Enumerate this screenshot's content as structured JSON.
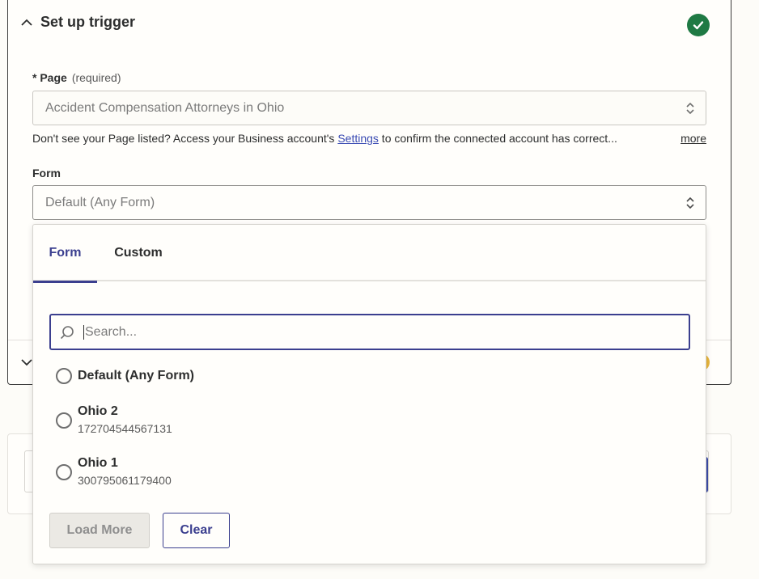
{
  "trigger": {
    "title": "Set up trigger",
    "status": "complete",
    "status_color": "#1f7a44"
  },
  "page_field": {
    "label": "Page",
    "required_marker": "*",
    "required_text": "(required)",
    "value": "Accident Compensation Attorneys in Ohio"
  },
  "help": {
    "prefix": "Don't see your Page listed? Access your Business account's ",
    "link": "Settings",
    "suffix": " to confirm the connected account has correct...",
    "more": "more"
  },
  "form_field": {
    "label": "Form",
    "value": "Default (Any Form)"
  },
  "dropdown": {
    "tabs": [
      {
        "label": "Form",
        "active": true
      },
      {
        "label": "Custom",
        "active": false
      }
    ],
    "search_placeholder": "Search...",
    "options": [
      {
        "label": "Default (Any Form)",
        "sub": ""
      },
      {
        "label": "Ohio 2",
        "sub": "172704544567131"
      },
      {
        "label": "Ohio 1",
        "sub": "300795061179400"
      }
    ],
    "load_more": "Load More",
    "clear": "Clear"
  },
  "colors": {
    "accent": "#3b3f8f",
    "link": "#3a4bb3",
    "warning": "#e8b53c"
  }
}
